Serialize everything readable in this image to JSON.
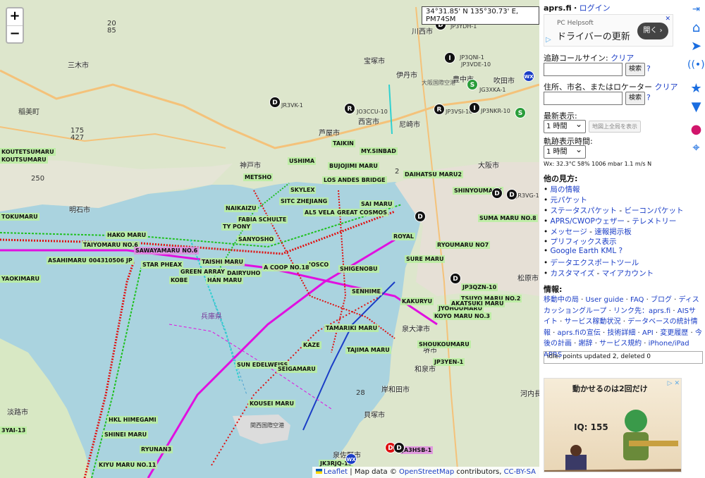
{
  "map": {
    "zoom_in": "+",
    "zoom_out": "−",
    "coords": "34°31.85' N 135°30.73' E, PM74SM",
    "attribution": {
      "leaflet": "Leaflet",
      "sep": " | Map data © ",
      "osm": "OpenStreetMap",
      "contrib": " contributors, ",
      "license": "CC-BY-SA"
    },
    "cities": [
      "三木市",
      "明石市",
      "神戸市",
      "芦屋市",
      "西宮市",
      "尼崎市",
      "宝塚市",
      "伊丹市",
      "豊中市",
      "吹田市",
      "大阪市",
      "川西市",
      "堺市",
      "和泉市",
      "岸和田市",
      "貝塚市",
      "泉佐野市",
      "淡路市",
      "松原市",
      "河内長",
      "泉大津市"
    ],
    "places": [
      "稲美町",
      "関西国際空港",
      "大阪国際空港",
      "兵庫県"
    ],
    "road_numbers": [
      "20",
      "85",
      "175",
      "427",
      "250",
      "2",
      "28"
    ],
    "ships": [
      "KOUTETSUMARU",
      "KOUTSUMARU",
      "TOKUMARU",
      "ASAHIMARU",
      "YAOKIMARU",
      "TAIYOMARU NO.6",
      "HAKO MARU",
      "SAWAYAMARU NO.6",
      "004310506 JP",
      "STAR PHEAX",
      "KOBE",
      "GREEN ARRAY",
      "TAISHI MARU",
      "DAIRYUHO",
      "HAN MARU",
      "SANYOSHO",
      "FABIA SCHULTE",
      "TY PONY",
      "NAIKAIZU",
      "METSHO",
      "SITC ZHEJIANG",
      "SKYLEX",
      "LOS ANDES BRIDGE",
      "MY.SINBAD",
      "TAIKIN",
      "USHIMA",
      "BUJOJIMI MARU",
      "DAIHATSU MARU2",
      "SHINYOUMARU",
      "AL5 VELA",
      "SAI MARU",
      "GREAT COSMOS",
      "SUMA MARU NO.8",
      "ROYAL",
      "JOSCO",
      "SHIGENOBU",
      "A COOP NO.18",
      "SENHIME",
      "KAKURYU",
      "SURE MARU",
      "RYOUMARU NO7",
      "TSUYO MARU NO.2",
      "JYOHOUMARU",
      "KOYO MARU NO.3",
      "AKATSUKI MARU",
      "JP3QZN-10",
      "TAMARIKI MARU",
      "TAJIMA MARU",
      "KAZE",
      "SUN EDELWEISS",
      "SEIGAMARU",
      "SHOUKOUMARU",
      "JP3YEN-1",
      "KOUSEI MARU",
      "HKL HIMEGAMI",
      "SHINEI MARU",
      "RYUNAN3",
      "KIYU MARU NO.11",
      "3YAI-13",
      "JK3RJQ-13",
      "JO3CCU-10",
      "JP3YDH-1",
      "JP3QNI-1",
      "JP3VDE-10",
      "JG3XKA-1",
      "JP3NKR-10",
      "JR3VK-1",
      "JP3VSI-10",
      "JR3VG-1",
      "JA3HSB-1"
    ]
  },
  "sidebar": {
    "site": "aprs.fi",
    "sep": "・",
    "login": "ログイン",
    "ad1": {
      "source": "PC Helpsoft",
      "headline": "ドライバーの更新",
      "button": "開く",
      "close": "✕"
    },
    "track_label": "追跡コールサイン:",
    "track_clear": "クリア",
    "search_btn": "検索",
    "help": "?",
    "addr_label": "住所、市名、またはロケーター",
    "addr_clear": "クリア",
    "latest_label": "最新表示:",
    "latest_value": "1 時間",
    "fullmap_btn": "地図上全局を表示",
    "track_time_label": "軌跡表示時間:",
    "track_time_value": "1 時間",
    "wx": "Wx: 32.3°C 58% 1006 mbar 1.1 m/s N",
    "other_views": "他の見方:",
    "links": [
      [
        "局の情報"
      ],
      [
        "元パケット"
      ],
      [
        "ステータスパケット",
        "ビーコンパケット"
      ],
      [
        "APRS/CWOPウェザー",
        "テレメトリー"
      ],
      [
        "メッセージ",
        "速報掲示板"
      ],
      [
        "プリフィックス表示"
      ],
      [
        "Google Earth KML ?"
      ],
      [
        "データエクスポートツール"
      ],
      [
        "カスタマイズ",
        "マイアカウント"
      ]
    ],
    "info_label": "情報:",
    "info_links": [
      "移動中の局",
      "User guide",
      "FAQ",
      "ブログ",
      "ディスカッショングループ",
      "リンク先：aprs.fi",
      "AISサイト",
      "サービス稼動状況",
      "データベースの統計情報",
      "aprs.fiの宣伝",
      "技術詳細",
      "API",
      "変更履歴",
      "今後の計画",
      "謝辞",
      "サービス規約",
      "iPhone/iPad APRS"
    ],
    "status": "idle: points updated 2, deleted 0",
    "ad2": {
      "title": "動かせるのは2回だけ",
      "iq": "IQ: 155"
    }
  },
  "colors": {
    "link": "#1a3dc6",
    "icon": "#1a6de0",
    "sea": "#aad3df",
    "land": "#dfe8ce",
    "track_green": "#20c020",
    "track_red": "#e01010",
    "track_magenta": "#e010e0"
  },
  "icons": [
    "collapse-icon",
    "home-icon",
    "locate-icon",
    "antenna-icon",
    "star-icon",
    "filter-icon",
    "community-icon",
    "compass-icon"
  ]
}
